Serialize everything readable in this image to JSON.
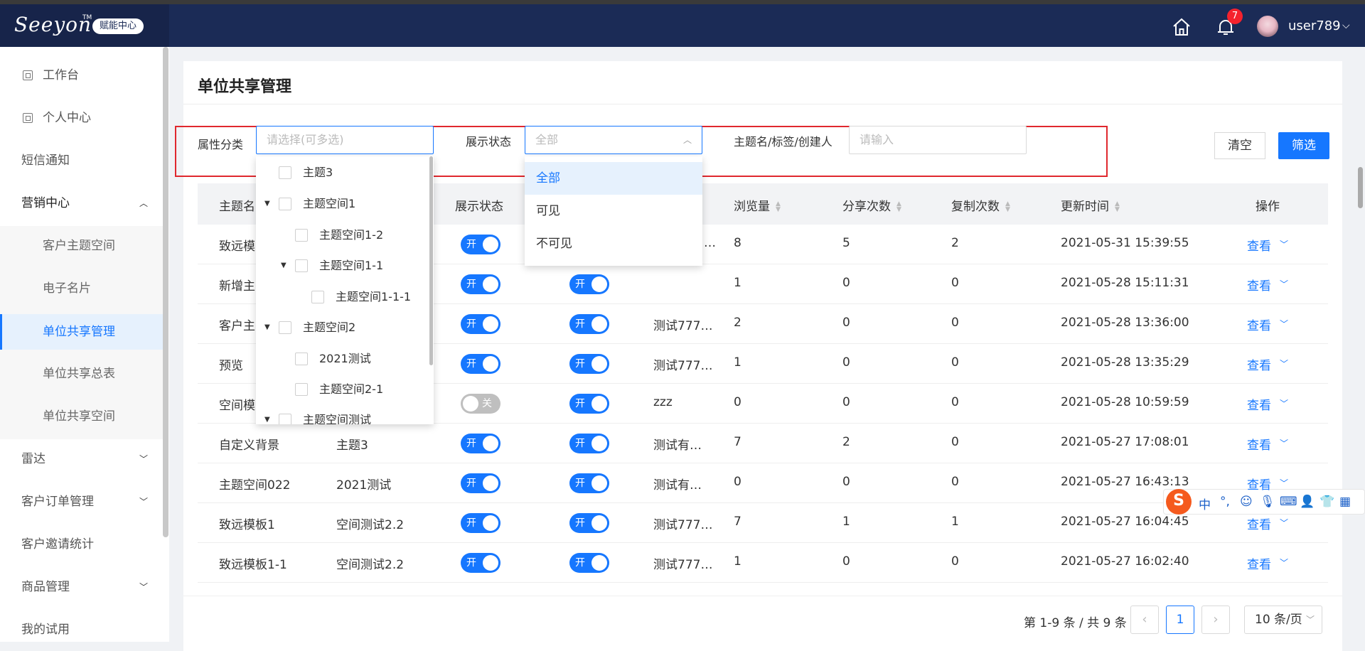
{
  "brand": {
    "logo_text": "Seeyon",
    "tm": "TM",
    "badge": "赋能中心"
  },
  "header": {
    "notifications_count": "7",
    "username": "user789"
  },
  "sidebar": {
    "items": [
      {
        "label": "工作台"
      },
      {
        "label": "个人中心"
      },
      {
        "label": "短信通知"
      },
      {
        "label": "营销中心"
      },
      {
        "label": "客户主题空间"
      },
      {
        "label": "电子名片"
      },
      {
        "label": "单位共享管理"
      },
      {
        "label": "单位共享总表"
      },
      {
        "label": "单位共享空间"
      },
      {
        "label": "雷达"
      },
      {
        "label": "客户订单管理"
      },
      {
        "label": "客户邀请统计"
      },
      {
        "label": "商品管理"
      },
      {
        "label": "我的试用"
      }
    ]
  },
  "page": {
    "title": "单位共享管理"
  },
  "filters": {
    "category_label": "属性分类",
    "category_placeholder": "请选择(可多选)",
    "status_label": "展示状态",
    "status_value": "全部",
    "keyword_label": "主题名/标签/创建人",
    "keyword_placeholder": "请输入",
    "clear_label": "清空",
    "filter_label": "筛选"
  },
  "category_tree": [
    {
      "label": "主题3"
    },
    {
      "label": "主题空间1"
    },
    {
      "label": "主题空间1-2"
    },
    {
      "label": "主题空间1-1"
    },
    {
      "label": "主题空间1-1-1"
    },
    {
      "label": "主题空间2"
    },
    {
      "label": "2021测试"
    },
    {
      "label": "主题空间2-1"
    },
    {
      "label": "主题空间测试"
    }
  ],
  "status_options": [
    {
      "label": "全部"
    },
    {
      "label": "可见"
    },
    {
      "label": "不可见"
    }
  ],
  "table": {
    "headers": {
      "name": "主题名",
      "display_status": "展示状态",
      "views": "浏览量",
      "shares": "分享次数",
      "copies": "复制次数",
      "updated": "更新时间",
      "ops": "操作"
    },
    "toggle_on": "开",
    "toggle_off": "关",
    "view_label": "查看",
    "rows": [
      {
        "name": "致远模",
        "category": "",
        "tags": "…",
        "views": "8",
        "shares": "5",
        "copies": "2",
        "updated": "2021-05-31 15:39:55"
      },
      {
        "name": "新增主",
        "category": "",
        "tags": "",
        "views": "1",
        "shares": "0",
        "copies": "0",
        "updated": "2021-05-28 15:11:31"
      },
      {
        "name": "客户主",
        "category": "",
        "tags": "测试777…",
        "views": "2",
        "shares": "0",
        "copies": "0",
        "updated": "2021-05-28 13:36:00"
      },
      {
        "name": "预览",
        "category": "",
        "tags": "测试777…",
        "views": "1",
        "shares": "0",
        "copies": "0",
        "updated": "2021-05-28 13:35:29"
      },
      {
        "name": "空间模",
        "category": "",
        "tags": "zzz",
        "views": "0",
        "shares": "0",
        "copies": "0",
        "updated": "2021-05-28 10:59:59"
      },
      {
        "name": "自定义背景",
        "category": "主题3",
        "tags": "测试有…",
        "views": "7",
        "shares": "2",
        "copies": "0",
        "updated": "2021-05-27 17:08:01"
      },
      {
        "name": "主题空间022",
        "category": "2021测试",
        "tags": "测试有…",
        "views": "0",
        "shares": "0",
        "copies": "0",
        "updated": "2021-05-27 16:43:13"
      },
      {
        "name": "致远模板1",
        "category": "空间测试2.2",
        "tags": "测试777…",
        "views": "7",
        "shares": "1",
        "copies": "1",
        "updated": "2021-05-27 16:04:45"
      },
      {
        "name": "致远模板1-1",
        "category": "空间测试2.2",
        "tags": "测试777…",
        "views": "1",
        "shares": "0",
        "copies": "0",
        "updated": "2021-05-27 16:02:40"
      }
    ]
  },
  "pagination": {
    "total_text": "第 1-9 条 / 共 9 条",
    "current_page": "1",
    "page_size": "10 条/页"
  },
  "ime": {
    "logo": "S",
    "lang": "中",
    "punct": "°,"
  }
}
